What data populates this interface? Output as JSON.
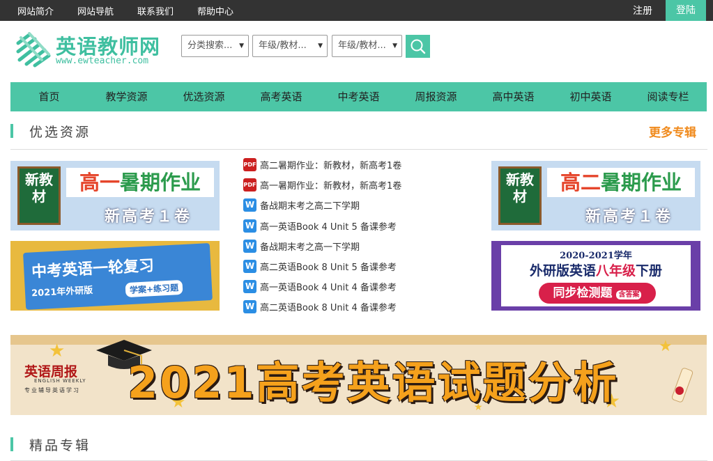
{
  "topbar": {
    "links": [
      "网站简介",
      "网站导航",
      "联系我们",
      "帮助中心"
    ],
    "register": "注册",
    "login": "登陆"
  },
  "logo": {
    "title": "英语教师网",
    "url": "www.ewteacher.com"
  },
  "search": {
    "selects": [
      "分类搜索...",
      "年级/教材...",
      "年级/教材..."
    ]
  },
  "nav": {
    "items": [
      "首页",
      "教学资源",
      "优选资源",
      "高考英语",
      "中考英语",
      "周报资源",
      "高中英语",
      "初中英语",
      "阅读专栏"
    ]
  },
  "section1": {
    "title": "优选资源",
    "more": "更多专辑"
  },
  "banners": {
    "left_top": {
      "chalk": "新教材",
      "main_a": "高一",
      "main_b": "暑期作业",
      "sub": "新高考１卷"
    },
    "left_bottom": {
      "title": "中考英语一轮复习",
      "sub": "2021年外研版",
      "tag": "学案+练习题"
    },
    "right_top": {
      "chalk": "新教材",
      "main_a": "高二",
      "main_b": "暑期作业",
      "sub": "新高考１卷"
    },
    "right_bottom": {
      "year": "2020-2021学年",
      "main_a": "外研版英语",
      "main_b": "八年级",
      "main_c": "下册",
      "btn": "同步检测题",
      "btn_tag": "含答案"
    }
  },
  "resources": [
    {
      "type": "pdf",
      "icon": "pdf-icon",
      "text": "高二暑期作业：新教材，新高考1卷"
    },
    {
      "type": "pdf",
      "icon": "pdf-icon",
      "text": "高一暑期作业：新教材，新高考1卷"
    },
    {
      "type": "w",
      "icon": "word-icon",
      "text": "备战期末考之高二下学期"
    },
    {
      "type": "w",
      "icon": "word-icon",
      "text": "高一英语Book 4 Unit 5 备课参考"
    },
    {
      "type": "w",
      "icon": "word-icon",
      "text": "备战期末考之高一下学期"
    },
    {
      "type": "w",
      "icon": "word-icon",
      "text": "高二英语Book 8 Unit 5 备课参考"
    },
    {
      "type": "w",
      "icon": "word-icon",
      "text": "高一英语Book 4 Unit 4 备课参考"
    },
    {
      "type": "w",
      "icon": "word-icon",
      "text": "高二英语Book 8 Unit 4 备课参考"
    }
  ],
  "big_banner": {
    "logo_cn": "英语周报",
    "logo_en": "ENGLISH WEEKLY",
    "logo_tag": "专业辅导英语学习",
    "title": "2021高考英语试题分析"
  },
  "section2": {
    "title": "精品专辑"
  },
  "colors": {
    "accent": "#4cc6a6",
    "more": "#f08a1c",
    "topbar": "#333333"
  }
}
